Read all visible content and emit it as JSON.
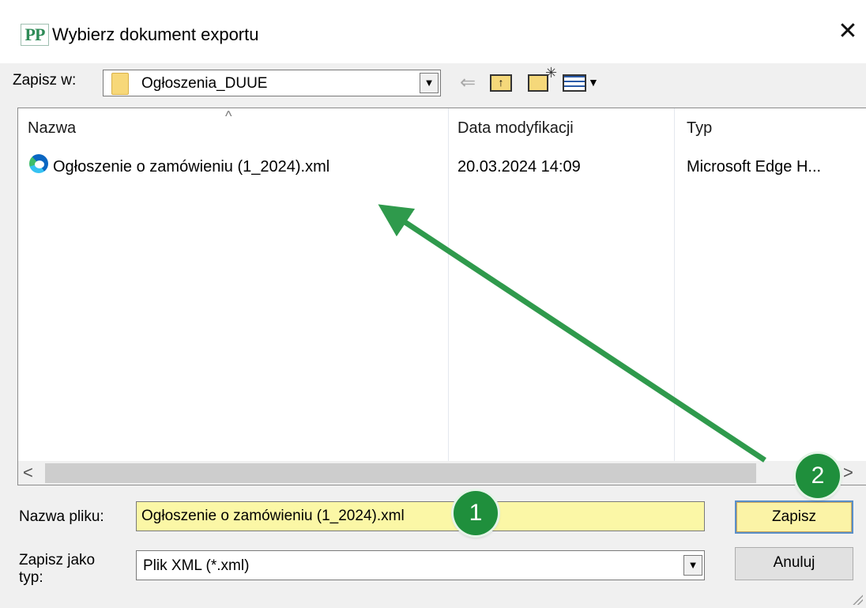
{
  "window": {
    "app_icon_text": "PP",
    "title": "Wybierz dokument exportu",
    "close_glyph": "✕"
  },
  "toolbar": {
    "save_in_label": "Zapisz w:",
    "folder": "Ogłoszenia_DUUE",
    "icons": [
      "back-arrow-icon",
      "up-folder-icon",
      "new-folder-icon",
      "view-menu-icon"
    ]
  },
  "file_list": {
    "columns": [
      "Nazwa",
      "Data modyfikacji",
      "Typ"
    ],
    "rows": [
      {
        "name": "Ogłoszenie o zamówieniu (1_2024).xml",
        "modified": "20.03.2024 14:09",
        "type": "Microsoft Edge H..."
      }
    ]
  },
  "form": {
    "filename_label": "Nazwa pliku:",
    "filename_value": "Ogłoszenie o zamówieniu (1_2024).xml",
    "filetype_label": "Zapisz jako\ntyp:",
    "filetype_value": "Plik XML (*.xml)"
  },
  "buttons": {
    "save": "Zapisz",
    "cancel": "Anuluj"
  },
  "annotations": {
    "step1": "1",
    "step2": "2",
    "color": "#1f8f3c"
  }
}
